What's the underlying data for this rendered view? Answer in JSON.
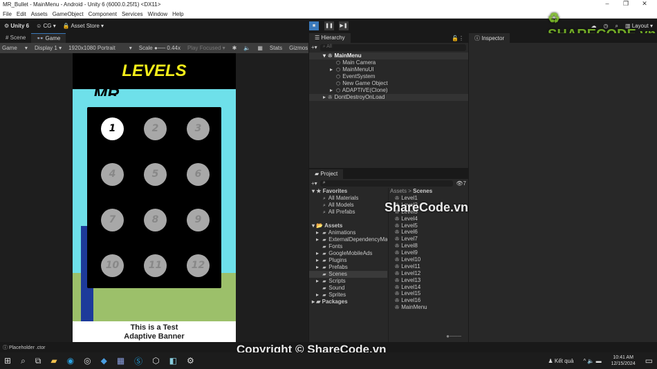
{
  "window": {
    "title": "MR_Bullet - MainMenu - Android - Unity 6 (6000.0.25f1) <DX11>",
    "minimize": "–",
    "maximize": "❐",
    "close": "✕"
  },
  "menu": [
    "File",
    "Edit",
    "Assets",
    "GameObject",
    "Component",
    "Services",
    "Window",
    "Help"
  ],
  "toolbar": {
    "unity": "Unity 6",
    "account": "CG",
    "asset_store": "Asset Store",
    "layout": "Layout"
  },
  "play_controls": {
    "play": "■",
    "pause": "❚❚",
    "step": "▶❚"
  },
  "tabs": {
    "scene": "Scene",
    "game": "Game",
    "hierarchy": "Hierarchy",
    "inspector": "Inspector",
    "project": "Project"
  },
  "gamebar": {
    "mode": "Game",
    "display": "Display 1",
    "resolution": "1920x1080 Portrait",
    "scale_label": "Scale",
    "scale_value": "0.44x",
    "play_focused": "Play Focused",
    "stats": "Stats",
    "gizmos": "Gizmos"
  },
  "game": {
    "title": "LEVELS",
    "logo_text": "MR",
    "levels": [
      "1",
      "2",
      "3",
      "4",
      "5",
      "6",
      "7",
      "8",
      "9",
      "10",
      "11",
      "12"
    ],
    "unlocked_levels": 1,
    "banner_line1": "This is a Test",
    "banner_line2": "Adaptive Banner",
    "title_color": "#f5ee1a"
  },
  "hierarchy": {
    "search_placeholder": "All",
    "scene": "MainMenu",
    "items": [
      "Main Camera",
      "MainMenuUI",
      "EventSystem",
      "New Game Object",
      "ADAPTIVE(Clone)"
    ],
    "dontdestroy": "DontDestroyOnLoad"
  },
  "project": {
    "favorites": "Favorites",
    "fav_items": [
      "All Materials",
      "All Models",
      "All Prefabs"
    ],
    "assets": "Assets",
    "folders": [
      "Animations",
      "ExternalDependencyMa",
      "Fonts",
      "GoogleMobileAds",
      "Plugins",
      "Prefabs",
      "Scenes",
      "Scripts",
      "Sound",
      "Sprites"
    ],
    "packages": "Packages",
    "breadcrumb_root": "Assets",
    "breadcrumb_current": "Scenes",
    "hidden_count": "7",
    "scenes": [
      "Level1",
      "Level2",
      "Level3",
      "Level4",
      "Level5",
      "Level6",
      "Level7",
      "Level8",
      "Level9",
      "Level10",
      "Level11",
      "Level12",
      "Level13",
      "Level14",
      "Level15",
      "Level16",
      "MainMenu"
    ]
  },
  "status": {
    "message": "Placeholder .ctor"
  },
  "taskbar": {
    "notification": "Kết quả",
    "time": "10:41 AM",
    "date": "12/15/2024"
  },
  "watermarks": {
    "logo": "SHARECODE.vn",
    "center": "ShareCode.vn",
    "copyright": "Copyright © ShareCode.vn"
  }
}
